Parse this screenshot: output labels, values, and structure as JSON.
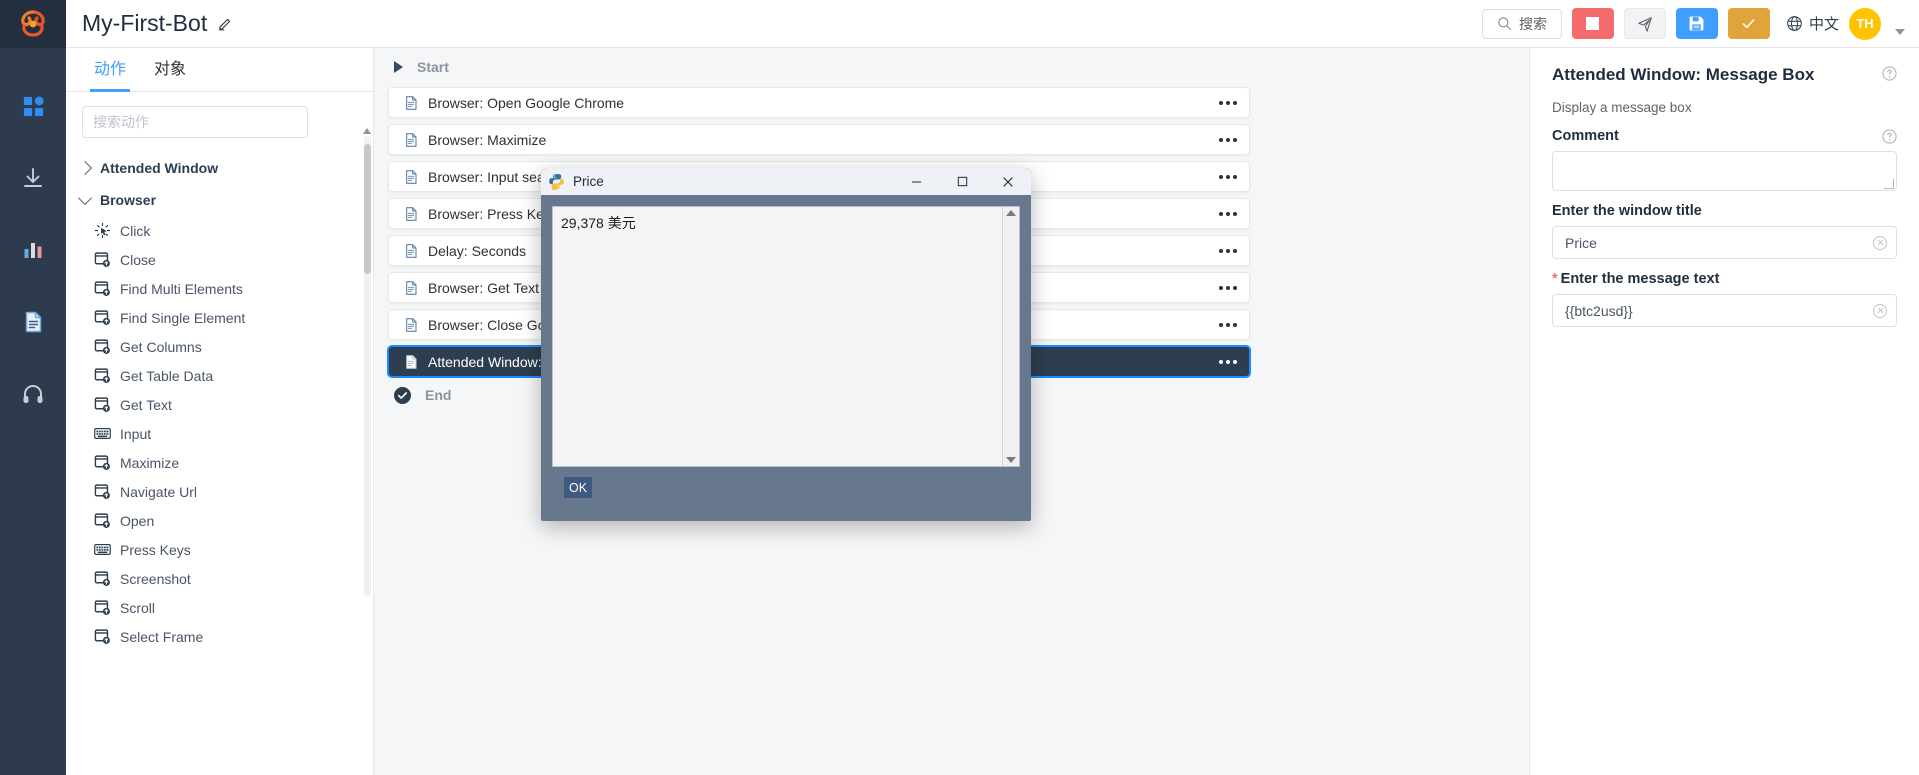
{
  "header": {
    "bot_name": "My-First-Bot",
    "edit_icon": "pencil-icon",
    "search_label": "搜索",
    "language_label": "中文",
    "avatar_initials": "TH",
    "buttons": {
      "stop": "stop-button",
      "run": "run-button",
      "save": "save-button",
      "confirm": "confirm-button"
    }
  },
  "rail": {
    "items": [
      {
        "name": "dashboard-icon",
        "active": true
      },
      {
        "name": "download-icon",
        "active": false
      },
      {
        "name": "analytics-icon",
        "active": false
      },
      {
        "name": "document-icon",
        "active": false
      },
      {
        "name": "support-icon",
        "active": false
      }
    ]
  },
  "actions_panel": {
    "tabs": [
      {
        "label": "动作",
        "active": true
      },
      {
        "label": "对象",
        "active": false
      }
    ],
    "search_placeholder": "搜索动作",
    "groups": [
      {
        "label": "Attended Window",
        "expanded": false,
        "items": []
      },
      {
        "label": "Browser",
        "expanded": true,
        "items": [
          {
            "label": "Click",
            "icon": "click-icon"
          },
          {
            "label": "Close",
            "icon": "browser-icon"
          },
          {
            "label": "Find Multi Elements",
            "icon": "browser-icon"
          },
          {
            "label": "Find Single Element",
            "icon": "browser-icon"
          },
          {
            "label": "Get Columns",
            "icon": "browser-icon"
          },
          {
            "label": "Get Table Data",
            "icon": "browser-icon"
          },
          {
            "label": "Get Text",
            "icon": "browser-icon"
          },
          {
            "label": "Input",
            "icon": "keyboard-icon"
          },
          {
            "label": "Maximize",
            "icon": "browser-icon"
          },
          {
            "label": "Navigate Url",
            "icon": "browser-icon"
          },
          {
            "label": "Open",
            "icon": "browser-icon"
          },
          {
            "label": "Press Keys",
            "icon": "keyboard-icon"
          },
          {
            "label": "Screenshot",
            "icon": "browser-icon"
          },
          {
            "label": "Scroll",
            "icon": "browser-icon"
          },
          {
            "label": "Select Frame",
            "icon": "browser-icon"
          }
        ]
      }
    ]
  },
  "canvas": {
    "start_label": "Start",
    "end_label": "End",
    "steps": [
      {
        "label": "Browser: Open Google Chrome",
        "selected": false
      },
      {
        "label": "Browser: Maximize",
        "selected": false
      },
      {
        "label": "Browser: Input search text \"b",
        "selected": false
      },
      {
        "label": "Browser: Press Keys \"Enter\"",
        "selected": false
      },
      {
        "label": "Delay: Seconds",
        "selected": false
      },
      {
        "label": "Browser: Get Text",
        "selected": false
      },
      {
        "label": "Browser: Close Google Chro",
        "selected": false
      },
      {
        "label": "Attended Window: Message",
        "selected": true
      }
    ]
  },
  "properties": {
    "title": "Attended Window: Message Box",
    "description": "Display a message box",
    "comment_label": "Comment",
    "comment_value": "",
    "window_title_label": "Enter the window title",
    "window_title_value": "Price",
    "message_text_label": "Enter the message text",
    "message_text_value": "{{btc2usd}}",
    "message_text_required": "*"
  },
  "dialog": {
    "title": "Price",
    "icon": "python-icon",
    "message": "29,378 美元",
    "ok_label": "OK",
    "minimize": "minimize-button",
    "maximize": "maximize-button",
    "close": "close-button"
  }
}
